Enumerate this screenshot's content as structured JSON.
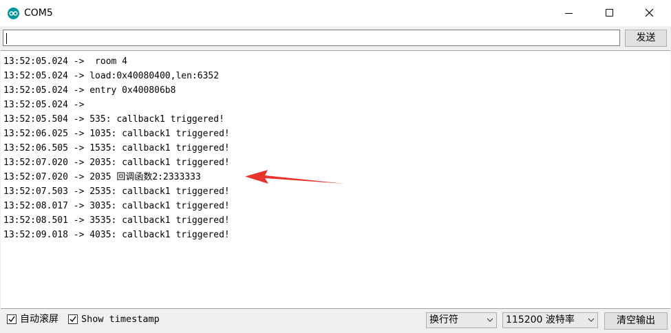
{
  "window": {
    "title": "COM5"
  },
  "command": {
    "input_value": "",
    "send_label": "发送"
  },
  "output": {
    "lines": [
      "13:52:05.024 ->  room 4",
      "13:52:05.024 -> load:0x40080400,len:6352",
      "13:52:05.024 -> entry 0x400806b8",
      "13:52:05.024 -> ",
      "13:52:05.504 -> 535: callback1 triggered!",
      "13:52:06.025 -> 1035: callback1 triggered!",
      "13:52:06.505 -> 1535: callback1 triggered!",
      "13:52:07.020 -> 2035: callback1 triggered!",
      "13:52:07.020 -> 2035 回调函数2:2333333",
      "13:52:07.503 -> 2535: callback1 triggered!",
      "13:52:08.017 -> 3035: callback1 triggered!",
      "13:52:08.501 -> 3535: callback1 triggered!",
      "13:52:09.018 -> 4035: callback1 triggered!"
    ],
    "annotation_color": "#e8332a"
  },
  "footer": {
    "autoscroll_label": "自动滚屏",
    "autoscroll_checked": true,
    "timestamp_label": "Show timestamp",
    "timestamp_checked": true,
    "line_ending": "换行符",
    "baud_rate": "115200 波特率",
    "clear_label": "清空输出"
  },
  "colors": {
    "app_icon": "#00979c",
    "window_bg": "#f0f0f0"
  }
}
